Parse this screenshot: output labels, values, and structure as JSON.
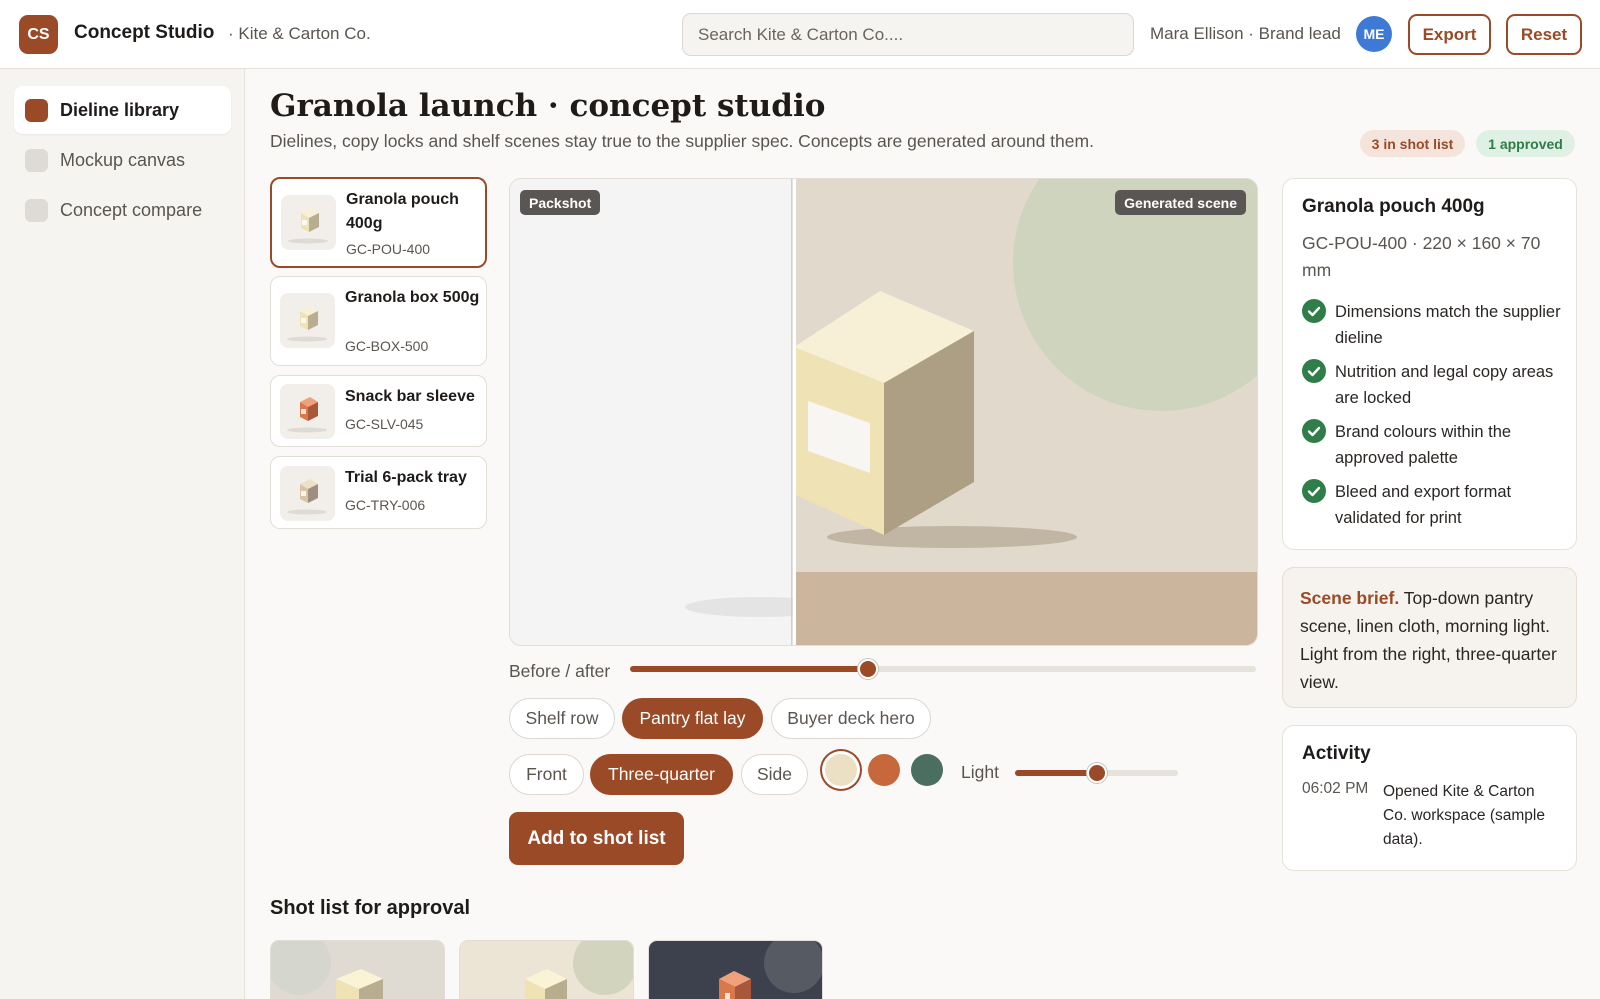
{
  "header": {
    "logo": "CS",
    "app_title": "Concept Studio",
    "workspace": "· Kite & Carton Co.",
    "search_placeholder": "Search Kite & Carton Co....",
    "user": "Mara Ellison · Brand lead",
    "avatar": "ME",
    "export_label": "Export",
    "reset_label": "Reset"
  },
  "sidebar": {
    "items": [
      {
        "label": "Dieline library",
        "active": true
      },
      {
        "label": "Mockup canvas",
        "active": false
      },
      {
        "label": "Concept compare",
        "active": false
      }
    ]
  },
  "page": {
    "title": "Granola launch · concept studio",
    "subtitle": "Dielines, copy locks and shelf scenes stay true to the supplier spec. Concepts are generated around them.",
    "badge_shot": "3 in shot list",
    "badge_approved": "1 approved"
  },
  "products": [
    {
      "name": "Granola pouch 400g",
      "sku": "GC-POU-400",
      "selected": true,
      "color": "#efe2b5"
    },
    {
      "name": "Granola box 500g",
      "sku": "GC-BOX-500",
      "selected": false,
      "color": "#efe2b5"
    },
    {
      "name": "Snack bar sleeve",
      "sku": "GC-SLV-045",
      "selected": false,
      "color": "#d9784a"
    },
    {
      "name": "Trial 6-pack tray",
      "sku": "GC-TRY-006",
      "selected": false,
      "color": "#d8c3a5"
    }
  ],
  "canvas": {
    "packshot_tag": "Packshot",
    "generated_tag": "Generated scene"
  },
  "controls": {
    "before_after_label": "Before / after",
    "before_after_value": 0.38,
    "scenes": [
      {
        "label": "Shelf row",
        "on": false
      },
      {
        "label": "Pantry flat lay",
        "on": true
      },
      {
        "label": "Buyer deck hero",
        "on": false
      }
    ],
    "angles": [
      {
        "label": "Front",
        "on": false
      },
      {
        "label": "Three-quarter",
        "on": true
      },
      {
        "label": "Side",
        "on": false
      }
    ],
    "swatches": [
      "#ece0c4",
      "#c7673c",
      "#4a6e5f"
    ],
    "light_label": "Light",
    "light_value": 0.5,
    "add_label": "Add to shot list"
  },
  "shot_list": {
    "title": "Shot list for approval"
  },
  "spec": {
    "title": "Granola pouch 400g",
    "subtitle": "GC-POU-400 · 220 × 160 × 70 mm",
    "checks": [
      "Dimensions match the supplier dieline",
      "Nutrition and legal copy areas are locked",
      "Brand colours within the approved palette",
      "Bleed and export format validated for print"
    ]
  },
  "brief": {
    "lead": "Scene brief.",
    "text": " Top-down pantry scene, linen cloth, morning light. Light from the right, three-quarter view."
  },
  "activity": {
    "title": "Activity",
    "time": "06:02 PM",
    "message": "Opened Kite & Carton Co. workspace (sample data)."
  }
}
